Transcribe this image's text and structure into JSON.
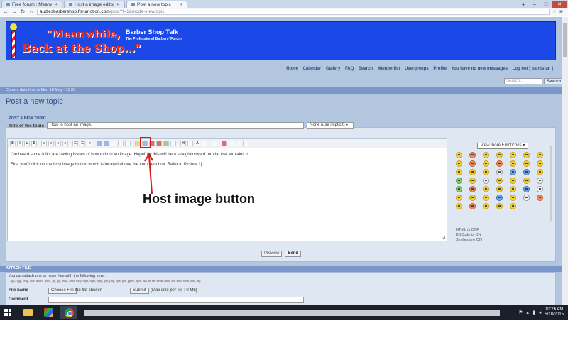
{
  "browser": {
    "tabs": [
      {
        "label": "Free forum : Meanwl"
      },
      {
        "label": "Host a image editor"
      },
      {
        "label": "Post a new topic"
      }
    ],
    "url_host": "audiesbarbershop.forumotion.com",
    "url_path": "/post?f=1&mode=newtopic"
  },
  "header": {
    "slogan_line1": "\"Meanwhile,",
    "slogan_line2": "Back at the Shop...\"",
    "site_title": "Barber Shop Talk",
    "site_description": "The Professional Barbers' Forum"
  },
  "nav": {
    "links": [
      "Home",
      "Calendar",
      "Gallery",
      "FAQ",
      "Search",
      "Memberlist",
      "Usergroups",
      "Profile",
      "You have no new messages",
      "Log out [ saintsfan ]"
    ],
    "search_placeholder": "Search...",
    "search_button": "Search"
  },
  "datebar": "Current date/time is Mon 18 May - 11:33",
  "page_title": "Post a new topic",
  "form": {
    "section_title": "POST A NEW TOPIC",
    "topic_label": "Title of the topic",
    "topic_value": "How to host an image.",
    "topic_type": "None (use implicit)",
    "toolbar": {
      "bold": "B",
      "italic": "I",
      "underline": "U",
      "strike": "S",
      "list": "H",
      "color": "A"
    },
    "body_paragraphs": [
      "I've heard some folks are having issues of how to host an image. Hopefully this will be a straightforward tutorial that explains it.",
      "First you'll click on the host image button which is located above the comment box. Refer to Picture 1|"
    ],
    "emoticons_button": "View more Emoticons",
    "status_lines": [
      "HTML is OFF",
      "BBCode is ON",
      "Smilies are ON"
    ],
    "preview_button": "Preview",
    "send_button": "Send"
  },
  "annotation": "Host image button",
  "colors": {
    "banner": "#1b49e8",
    "highlight": "#d8171b",
    "page_bg": "#b3c6df"
  },
  "attach": {
    "section_title": "ATTACH FILE",
    "description": "You can attach one or more files with the following form :",
    "types": "( 3g2, 3gp, bmp, doc, docm, docx, gif, jpg, m4a, m4v, mov, mp3, mp4, mpg, pdf, png, pps, ppt, pptm, pptx, swf, tif, tiff, wma, wmv, xls, xlsb, xlsm, xlsx, zip )",
    "filename_label": "File name",
    "choose_button": "Choose File",
    "no_file": "No file chosen",
    "submit_button": "Submit",
    "max_size": "(Max size per file : 0 Mb)",
    "comment_label": "Comment"
  },
  "taskbar": {
    "time": "10:26 AM",
    "date": "5/18/2015"
  }
}
